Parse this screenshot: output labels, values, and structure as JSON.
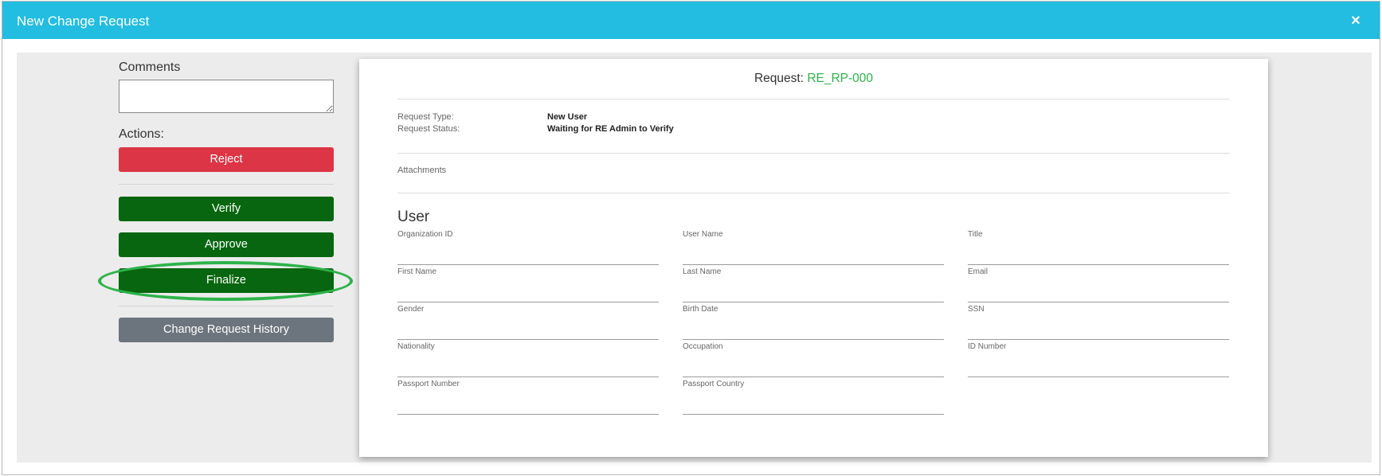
{
  "modal": {
    "title": "New Change Request",
    "close_icon": "×"
  },
  "left": {
    "comments_label": "Comments",
    "comments_value": "",
    "actions_label": "Actions:",
    "buttons": {
      "reject": "Reject",
      "verify": "Verify",
      "approve": "Approve",
      "finalize": "Finalize",
      "history": "Change Request History"
    }
  },
  "request": {
    "title_prefix": "Request:",
    "id": "RE_RP-000",
    "type_label": "Request Type:",
    "type_value": "New User",
    "status_label": "Request Status:",
    "status_value": "Waiting for RE Admin to Verify",
    "attachments_label": "Attachments"
  },
  "user": {
    "section_title": "User",
    "fields": [
      {
        "label": "Organization ID",
        "value": ""
      },
      {
        "label": "User Name",
        "value": ""
      },
      {
        "label": "Title",
        "value": ""
      },
      {
        "label": "First Name",
        "value": ""
      },
      {
        "label": "Last Name",
        "value": ""
      },
      {
        "label": "Email",
        "value": ""
      },
      {
        "label": "Gender",
        "value": ""
      },
      {
        "label": "Birth Date",
        "value": ""
      },
      {
        "label": "SSN",
        "value": ""
      },
      {
        "label": "Nationality",
        "value": ""
      },
      {
        "label": "Occupation",
        "value": ""
      },
      {
        "label": "ID Number",
        "value": ""
      },
      {
        "label": "Passport Number",
        "value": ""
      },
      {
        "label": "Passport Country",
        "value": ""
      }
    ]
  },
  "colors": {
    "header": "#22bde0",
    "reject": "#dc3545",
    "action_green": "#07660f",
    "history_gray": "#6c757d",
    "highlight": "#2db34a",
    "request_id": "#2db34a"
  }
}
